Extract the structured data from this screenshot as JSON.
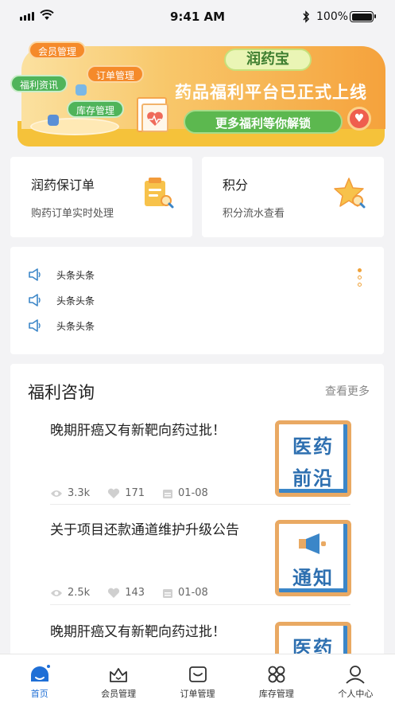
{
  "status_bar": {
    "time": "9:41 AM",
    "battery": "100%"
  },
  "banner": {
    "brand": "润药宝",
    "headline": "药品福利平台已正式上线",
    "cta": "更多福利等你解锁",
    "bubbles": [
      "会员管理",
      "订单管理",
      "福利资讯",
      "库存管理"
    ]
  },
  "quick_cards": [
    {
      "title": "润药保订单",
      "subtitle": "购药订单实时处理",
      "icon": "order-clipboard-icon"
    },
    {
      "title": "积分",
      "subtitle": "积分流水查看",
      "icon": "star-points-icon"
    }
  ],
  "headlines": {
    "items": [
      "头条头条",
      "头条头条",
      "头条头条"
    ],
    "page_count": 3,
    "active_page": 1
  },
  "news": {
    "heading": "福利咨询",
    "more": "查看更多",
    "items": [
      {
        "title": "晚期肝癌又有新靶向药过批！",
        "views": "3.3k",
        "likes": "171",
        "date": "01-08",
        "thumb_lines": [
          "医药",
          "前沿"
        ]
      },
      {
        "title": "关于项目还款通道维护升级公告",
        "views": "2.5k",
        "likes": "143",
        "date": "01-08",
        "thumb_lines": [
          "",
          "通知"
        ]
      },
      {
        "title": "晚期肝癌又有新靶向药过批！",
        "thumb_lines": [
          "医药",
          ""
        ]
      }
    ]
  },
  "tab_bar": {
    "active": "首页",
    "tabs": [
      "首页",
      "会员管理",
      "订单管理",
      "库存管理",
      "个人中心"
    ]
  },
  "colors": {
    "accent_blue": "#1f6fd6",
    "banner_orange": "#f5a23c",
    "banner_green": "#5cb84f",
    "thumb_blue": "#2d6fb0",
    "thumb_orange": "#e9a963"
  }
}
